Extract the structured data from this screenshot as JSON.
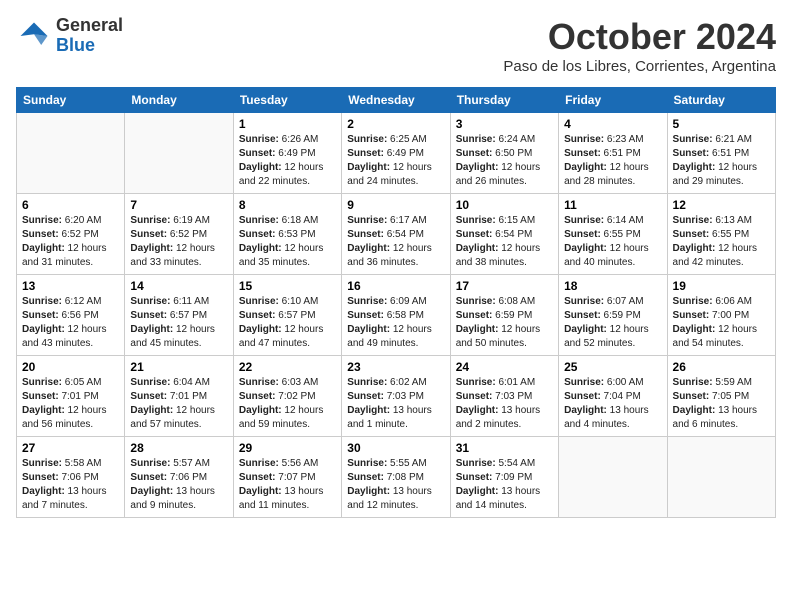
{
  "header": {
    "logo_line1": "General",
    "logo_line2": "Blue",
    "month": "October 2024",
    "location": "Paso de los Libres, Corrientes, Argentina"
  },
  "weekdays": [
    "Sunday",
    "Monday",
    "Tuesday",
    "Wednesday",
    "Thursday",
    "Friday",
    "Saturday"
  ],
  "weeks": [
    [
      {
        "day": "",
        "empty": true
      },
      {
        "day": "",
        "empty": true
      },
      {
        "day": "1",
        "sunrise": "6:26 AM",
        "sunset": "6:49 PM",
        "daylight": "12 hours and 22 minutes."
      },
      {
        "day": "2",
        "sunrise": "6:25 AM",
        "sunset": "6:49 PM",
        "daylight": "12 hours and 24 minutes."
      },
      {
        "day": "3",
        "sunrise": "6:24 AM",
        "sunset": "6:50 PM",
        "daylight": "12 hours and 26 minutes."
      },
      {
        "day": "4",
        "sunrise": "6:23 AM",
        "sunset": "6:51 PM",
        "daylight": "12 hours and 28 minutes."
      },
      {
        "day": "5",
        "sunrise": "6:21 AM",
        "sunset": "6:51 PM",
        "daylight": "12 hours and 29 minutes."
      }
    ],
    [
      {
        "day": "6",
        "sunrise": "6:20 AM",
        "sunset": "6:52 PM",
        "daylight": "12 hours and 31 minutes."
      },
      {
        "day": "7",
        "sunrise": "6:19 AM",
        "sunset": "6:52 PM",
        "daylight": "12 hours and 33 minutes."
      },
      {
        "day": "8",
        "sunrise": "6:18 AM",
        "sunset": "6:53 PM",
        "daylight": "12 hours and 35 minutes."
      },
      {
        "day": "9",
        "sunrise": "6:17 AM",
        "sunset": "6:54 PM",
        "daylight": "12 hours and 36 minutes."
      },
      {
        "day": "10",
        "sunrise": "6:15 AM",
        "sunset": "6:54 PM",
        "daylight": "12 hours and 38 minutes."
      },
      {
        "day": "11",
        "sunrise": "6:14 AM",
        "sunset": "6:55 PM",
        "daylight": "12 hours and 40 minutes."
      },
      {
        "day": "12",
        "sunrise": "6:13 AM",
        "sunset": "6:55 PM",
        "daylight": "12 hours and 42 minutes."
      }
    ],
    [
      {
        "day": "13",
        "sunrise": "6:12 AM",
        "sunset": "6:56 PM",
        "daylight": "12 hours and 43 minutes."
      },
      {
        "day": "14",
        "sunrise": "6:11 AM",
        "sunset": "6:57 PM",
        "daylight": "12 hours and 45 minutes."
      },
      {
        "day": "15",
        "sunrise": "6:10 AM",
        "sunset": "6:57 PM",
        "daylight": "12 hours and 47 minutes."
      },
      {
        "day": "16",
        "sunrise": "6:09 AM",
        "sunset": "6:58 PM",
        "daylight": "12 hours and 49 minutes."
      },
      {
        "day": "17",
        "sunrise": "6:08 AM",
        "sunset": "6:59 PM",
        "daylight": "12 hours and 50 minutes."
      },
      {
        "day": "18",
        "sunrise": "6:07 AM",
        "sunset": "6:59 PM",
        "daylight": "12 hours and 52 minutes."
      },
      {
        "day": "19",
        "sunrise": "6:06 AM",
        "sunset": "7:00 PM",
        "daylight": "12 hours and 54 minutes."
      }
    ],
    [
      {
        "day": "20",
        "sunrise": "6:05 AM",
        "sunset": "7:01 PM",
        "daylight": "12 hours and 56 minutes."
      },
      {
        "day": "21",
        "sunrise": "6:04 AM",
        "sunset": "7:01 PM",
        "daylight": "12 hours and 57 minutes."
      },
      {
        "day": "22",
        "sunrise": "6:03 AM",
        "sunset": "7:02 PM",
        "daylight": "12 hours and 59 minutes."
      },
      {
        "day": "23",
        "sunrise": "6:02 AM",
        "sunset": "7:03 PM",
        "daylight": "13 hours and 1 minute."
      },
      {
        "day": "24",
        "sunrise": "6:01 AM",
        "sunset": "7:03 PM",
        "daylight": "13 hours and 2 minutes."
      },
      {
        "day": "25",
        "sunrise": "6:00 AM",
        "sunset": "7:04 PM",
        "daylight": "13 hours and 4 minutes."
      },
      {
        "day": "26",
        "sunrise": "5:59 AM",
        "sunset": "7:05 PM",
        "daylight": "13 hours and 6 minutes."
      }
    ],
    [
      {
        "day": "27",
        "sunrise": "5:58 AM",
        "sunset": "7:06 PM",
        "daylight": "13 hours and 7 minutes."
      },
      {
        "day": "28",
        "sunrise": "5:57 AM",
        "sunset": "7:06 PM",
        "daylight": "13 hours and 9 minutes."
      },
      {
        "day": "29",
        "sunrise": "5:56 AM",
        "sunset": "7:07 PM",
        "daylight": "13 hours and 11 minutes."
      },
      {
        "day": "30",
        "sunrise": "5:55 AM",
        "sunset": "7:08 PM",
        "daylight": "13 hours and 12 minutes."
      },
      {
        "day": "31",
        "sunrise": "5:54 AM",
        "sunset": "7:09 PM",
        "daylight": "13 hours and 14 minutes."
      },
      {
        "day": "",
        "empty": true
      },
      {
        "day": "",
        "empty": true
      }
    ]
  ],
  "labels": {
    "sunrise": "Sunrise: ",
    "sunset": "Sunset: ",
    "daylight": "Daylight: "
  }
}
